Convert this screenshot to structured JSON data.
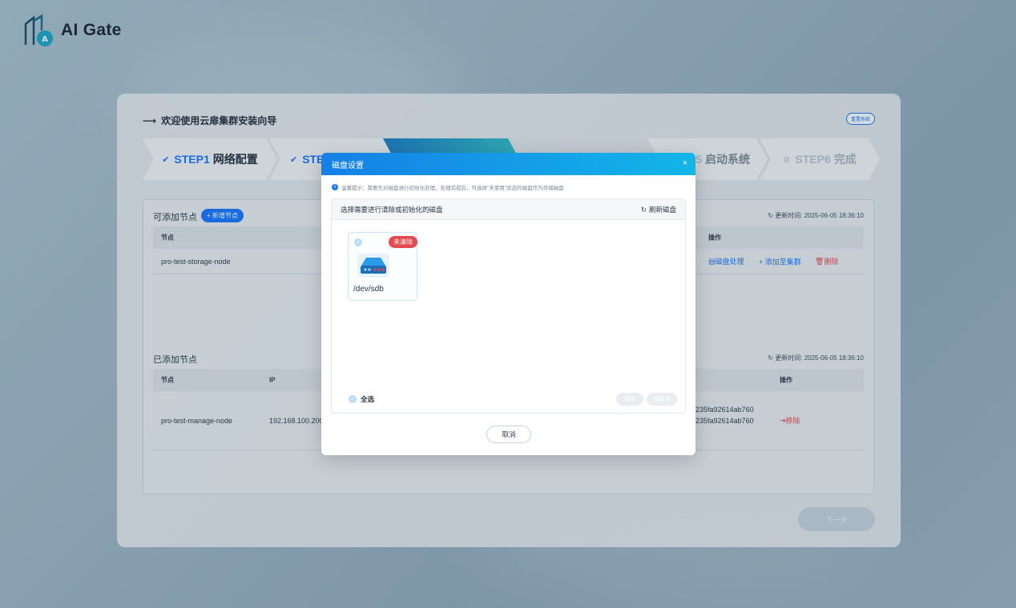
{
  "brand": {
    "logo_text": "AI Gate"
  },
  "wizard": {
    "title": "欢迎使用云扉集群安装向导",
    "reset_label": "重置系统",
    "steps": [
      {
        "num": "STEP1",
        "label": "网络配置"
      },
      {
        "num": "STE",
        "label": ""
      },
      {
        "num": "P5",
        "label": "启动系统"
      },
      {
        "num": "STEP6",
        "label": "完成"
      }
    ],
    "next_label": "下一步"
  },
  "addable": {
    "title": "可添加节点",
    "add_button": "+ 新增节点",
    "updated": "更新时间: 2025-06-05 18:36:10",
    "columns": {
      "node": "节点",
      "ops": "操作"
    },
    "rows": [
      {
        "node": "pro-test-storage-node",
        "op_disk": "磁盘处理",
        "op_add": "+ 添加至集群",
        "op_delete": "删除"
      }
    ]
  },
  "added": {
    "title": "已添加节点",
    "updated": "更新时间: 2025-06-05 18:36:10",
    "columns": {
      "node": "节点",
      "ip": "IP",
      "ops": "操作"
    },
    "rows": [
      {
        "node": "pro-test-manage-node",
        "ip": "192.168.100.200",
        "id1": "235fa92614ab760",
        "id2": "235fa92614ab760",
        "op_remove": "移除"
      }
    ]
  },
  "modal": {
    "title": "磁盘设置",
    "close": "×",
    "tip": "温馨提示：需要先对磁盘进行初始化处理，处理完成后，可选择\"未使用\"状态的磁盘作为存储磁盘",
    "panel_title": "选择需要进行清除或初始化的磁盘",
    "refresh_label": "刷新磁盘",
    "disks": [
      {
        "name": "/dev/sdb",
        "status": "未清除"
      }
    ],
    "select_all": "全选",
    "clear_label": "清除",
    "init_label": "初始化",
    "cancel_label": "取消"
  }
}
